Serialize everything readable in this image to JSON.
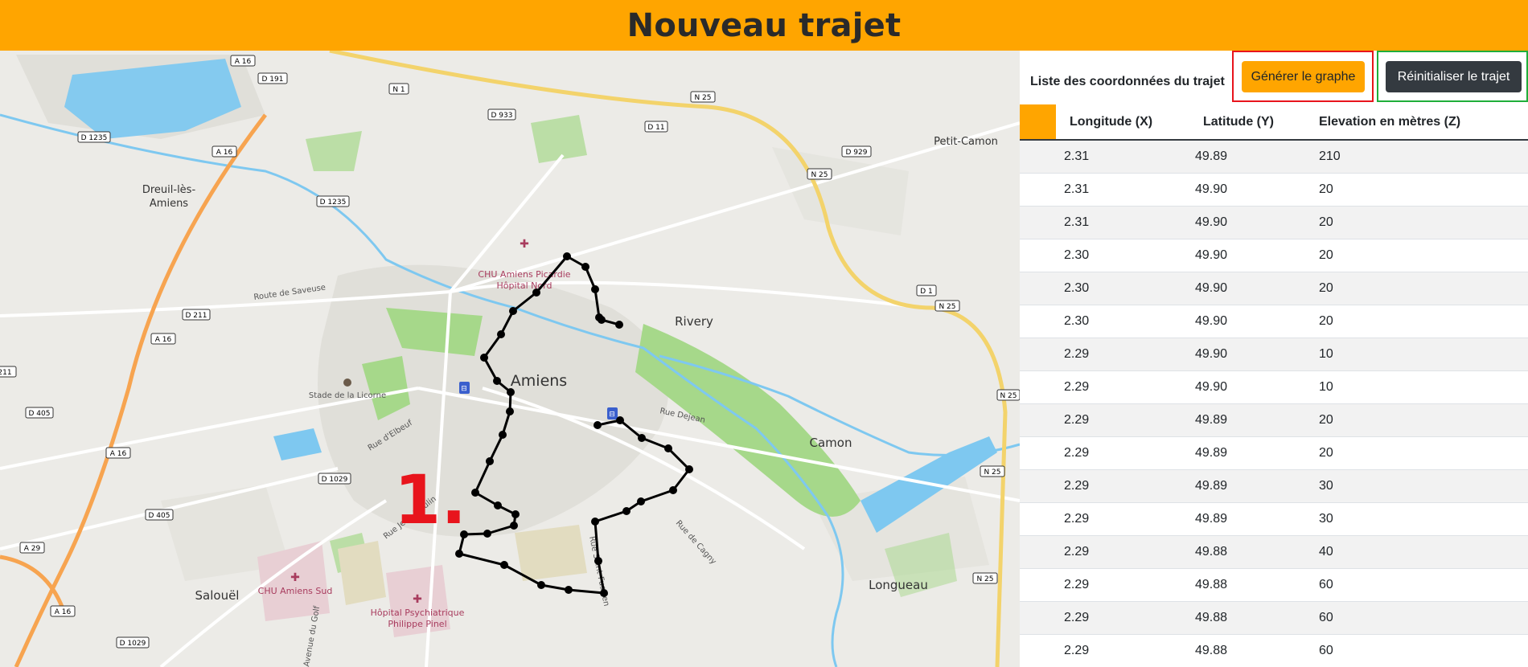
{
  "header": {
    "title": "Nouveau trajet"
  },
  "panel": {
    "title": "Liste des coordonnées du trajet",
    "generate_label": "Générer le graphe",
    "reset_label": "Réinitialiser le trajet"
  },
  "table": {
    "columns": [
      "",
      "Longitude (X)",
      "Latitude (Y)",
      "Elevation en mètres (Z)"
    ],
    "rows": [
      [
        "2.31",
        "49.89",
        "210"
      ],
      [
        "2.31",
        "49.90",
        "20"
      ],
      [
        "2.31",
        "49.90",
        "20"
      ],
      [
        "2.30",
        "49.90",
        "20"
      ],
      [
        "2.30",
        "49.90",
        "20"
      ],
      [
        "2.30",
        "49.90",
        "20"
      ],
      [
        "2.29",
        "49.90",
        "10"
      ],
      [
        "2.29",
        "49.90",
        "10"
      ],
      [
        "2.29",
        "49.89",
        "20"
      ],
      [
        "2.29",
        "49.89",
        "20"
      ],
      [
        "2.29",
        "49.89",
        "30"
      ],
      [
        "2.29",
        "49.89",
        "30"
      ],
      [
        "2.29",
        "49.88",
        "40"
      ],
      [
        "2.29",
        "49.88",
        "60"
      ],
      [
        "2.29",
        "49.88",
        "60"
      ],
      [
        "2.29",
        "49.88",
        "60"
      ]
    ]
  },
  "map": {
    "annotation": "1.",
    "places": {
      "amiens": "Amiens",
      "rivery": "Rivery",
      "camon": "Camon",
      "longueau": "Longueau",
      "salouel": "Salouël",
      "petit_camon": "Petit-Camon",
      "dreuil_1": "Dreuil-lès-",
      "dreuil_2": "Amiens",
      "stade": "Stade de la Licorne",
      "chu_nord_1": "CHU Amiens Picardie",
      "chu_nord_2": "Hôpital Nord",
      "chu_sud": "CHU Amiens Sud",
      "pinel_1": "Hôpital Psychiatrique",
      "pinel_2": "Philippe Pinel"
    },
    "streets": {
      "saveuse": "Route de Saveuse",
      "elbeuf": "Rue d'Elbeuf",
      "moulin": "Rue Jean Moulin",
      "dejean": "Rue Dejean",
      "cagny": "Rue de Cagny",
      "saint_fuscien": "Rue Saint-Fuscien",
      "golf": "Avenue du Golf"
    },
    "roads": {
      "a16_top": "A 16",
      "d191": "D 191",
      "n1": "N 1",
      "d933": "D 933",
      "d11": "D 11",
      "n25_top": "N 25",
      "d1235_a": "D 1235",
      "a16_b": "A 16",
      "d929": "D 929",
      "n25_b": "N 25",
      "d1235_b": "D 1235",
      "d211": "D 211",
      "a16_c": "A 16",
      "d1": "D 1",
      "n25_c": "N 25",
      "d211_edge": "211",
      "d405_a": "D 405",
      "n25_d": "N 25",
      "a16_d": "A 16",
      "d1029_a": "D 1029",
      "n25_e": "N 25",
      "d405_b": "D 405",
      "a29": "A 29",
      "n25_f": "N 25",
      "a16_e": "A 16",
      "d1029_b": "D 1029"
    },
    "route_color": "#000000",
    "annotation_color": "#e8141c"
  }
}
